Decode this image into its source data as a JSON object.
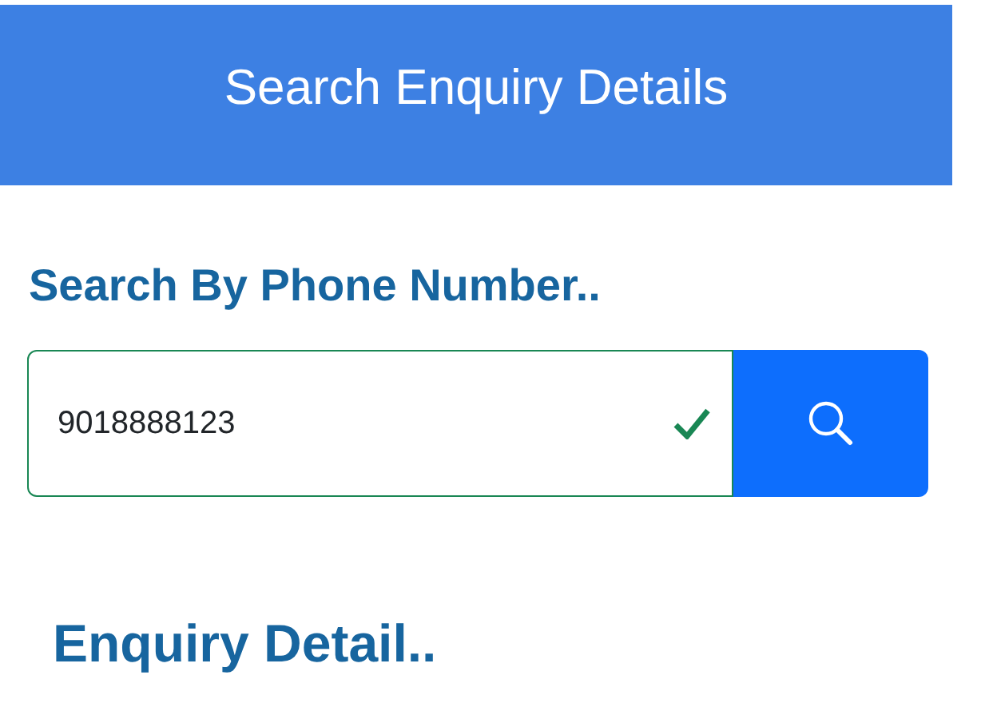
{
  "header": {
    "title": "Search Enquiry Details"
  },
  "search": {
    "label": "Search By Phone Number..",
    "value": "9018888123",
    "valid": true
  },
  "results": {
    "title": "Enquiry Detail.."
  }
}
